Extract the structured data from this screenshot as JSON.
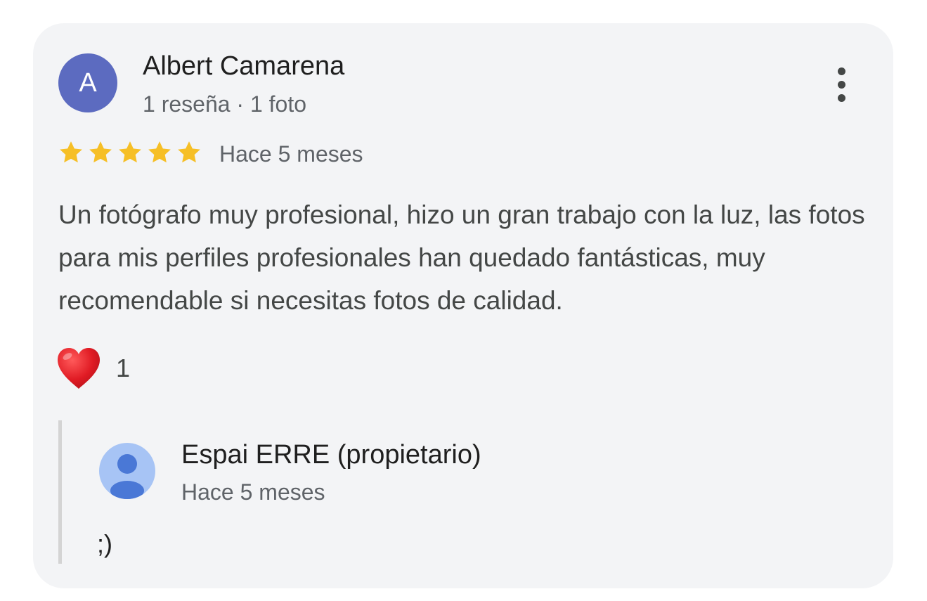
{
  "review": {
    "author": {
      "initial": "A",
      "avatar_color": "#5c6bc0",
      "name": "Albert Camarena",
      "meta": "1 reseña · 1 foto"
    },
    "rating": 5,
    "max_rating": 5,
    "star_color": "#f6bf26",
    "date": "Hace 5 meses",
    "text": "Un fotógrafo muy profesional, hizo un gran trabajo con la luz, las fotos para mis perfiles profesionales han quedado fantásticas, muy recomendable si necesitas fotos de calidad.",
    "reactions": {
      "icon": "heart-icon",
      "count": "1"
    },
    "more_options_icon": "more-vert-icon"
  },
  "owner_reply": {
    "name": "Espai ERRE (propietario)",
    "date": "Hace 5 meses",
    "text": ";)",
    "avatar_icon": "person-icon",
    "avatar_color": "#a7c4f5"
  }
}
